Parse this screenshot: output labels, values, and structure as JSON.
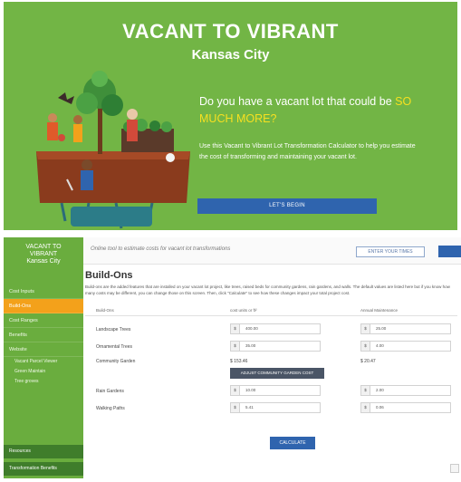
{
  "hero": {
    "title": "VACANT TO VIBRANT",
    "subtitle": "Kansas City",
    "question_prefix": "Do you have a vacant lot that could be",
    "question_highlight": "SO MUCH MORE?",
    "description": "Use this Vacant to Vibrant Lot Transformation Calculator to help you estimate the cost of transforming and maintaining your vacant lot.",
    "cta_label": "LET'S BEGIN",
    "highlight_color": "#f6e020",
    "background_color": "#72b545"
  },
  "app": {
    "sidebar": {
      "title_line1": "VACANT TO",
      "title_line2": "VIBRANT",
      "title_line3": "Kansas City",
      "items": [
        {
          "label": "Cost Inputs"
        },
        {
          "label": "Build-Ons"
        },
        {
          "label": "Cost Ranges"
        },
        {
          "label": "Benefits"
        },
        {
          "label": "Website"
        }
      ],
      "sub_items": [
        {
          "label": "Vacant Parcel Viewer"
        },
        {
          "label": "Green Maintain"
        },
        {
          "label": "Tree groves"
        }
      ],
      "bottom_items": [
        {
          "label": "Resources"
        },
        {
          "label": "Transformation Benefits"
        }
      ]
    },
    "topbar": {
      "text": "Online tool to estimate costs for vacant lot transformations",
      "outline_button": "ENTER YOUR TIMES"
    },
    "page": {
      "title": "Build-Ons",
      "intro": "Build-ons are the added features that are installed on your vacant lot project, like trees, raised beds for community gardens, rain gardens, and walls. The default values are listed here but if you know how many costs may be different, you can change those on this screen. Then, click \"Calculate\" to see how these changes impact your total project cost."
    },
    "table": {
      "headers": [
        "Build-Ons",
        "cost units or ft²",
        "Annual Maintenance"
      ],
      "rows": [
        {
          "label": "Landscape Trees",
          "prefix": "$",
          "cost": "400.00",
          "maintenance": "25.00"
        },
        {
          "label": "Ornamental Trees",
          "prefix": "$",
          "cost": "35.00",
          "maintenance": "4.00"
        },
        {
          "label": "Community Garden",
          "cost_text": "$ 153.46",
          "maintenance_text": "$ 20.47"
        },
        {
          "label": "Rain Gardens",
          "prefix": "$",
          "cost": "10.00",
          "maintenance": "2.00"
        },
        {
          "label": "Walking Paths",
          "prefix": "$",
          "cost": "5.41",
          "maintenance": "0.06"
        }
      ],
      "adjust_button": "ADJUST COMMUNITY GARDEN COST",
      "calculate_button": "CALCULATE"
    }
  }
}
